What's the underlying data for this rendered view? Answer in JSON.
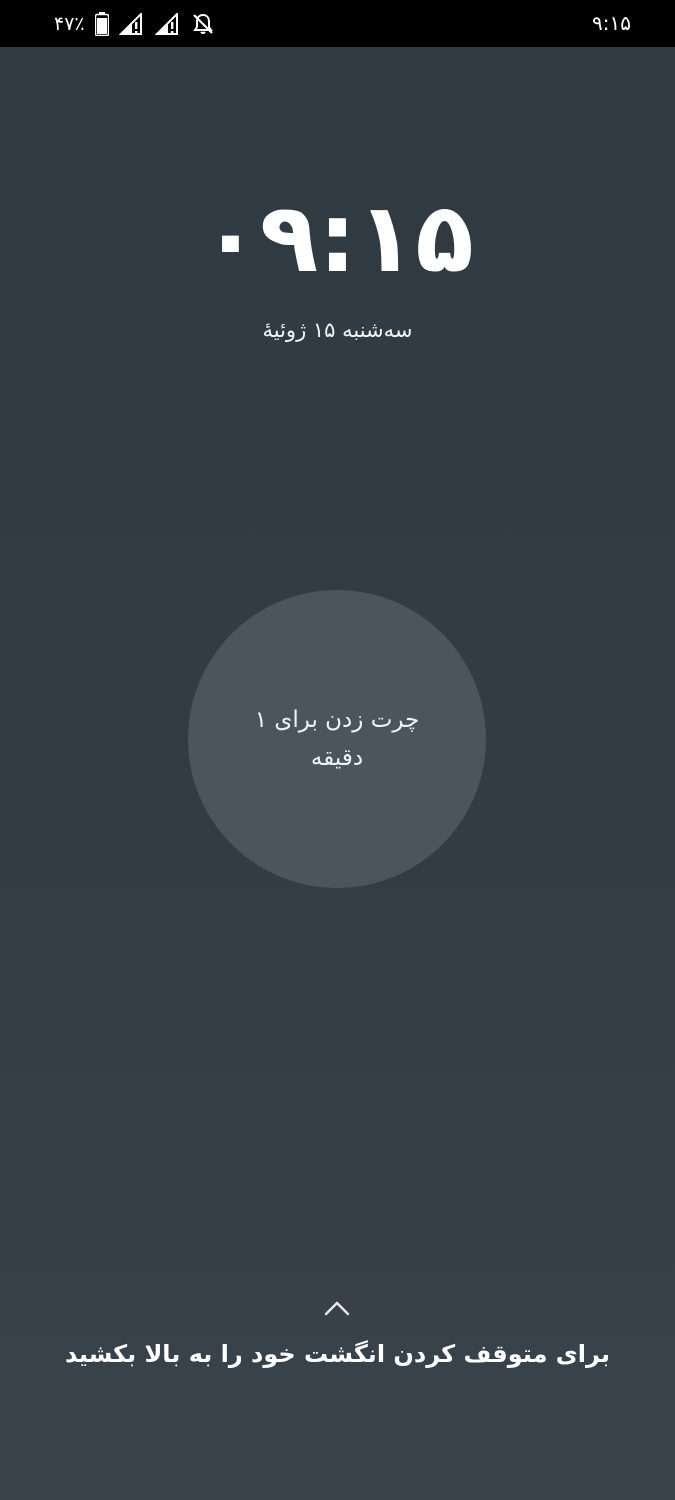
{
  "status_bar": {
    "battery_percent": "۴۷٪",
    "time": "۹:۱۵",
    "icons": [
      "battery-icon",
      "signal-no-service-icon",
      "signal-no-service-icon",
      "notifications-off-icon"
    ]
  },
  "lock_screen": {
    "clock": "۰۹:۱۵",
    "date": "سه‌شنبه ۱۵ ژوئیهٔ"
  },
  "alarm": {
    "snooze_label": "چرت زدن برای ۱ دقیقه",
    "swipe_hint": "برای متوقف کردن انگشت خود را به بالا بکشید",
    "swipe_icon": "chevron-up-icon"
  },
  "colors": {
    "background": "#323c44",
    "status_bar": "#000000",
    "snooze_circle": "#4a555d",
    "text": "#ffffff"
  }
}
